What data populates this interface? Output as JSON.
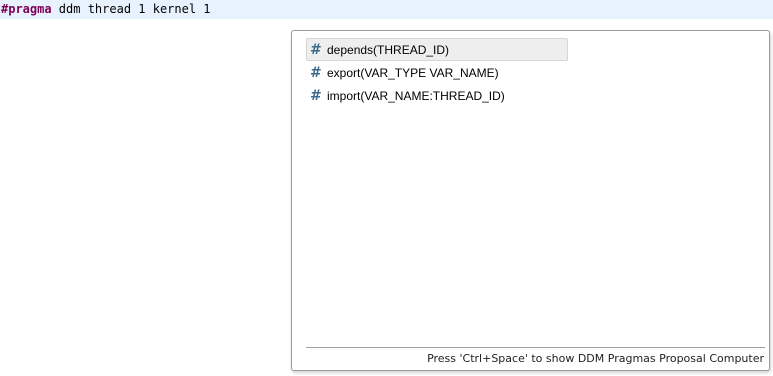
{
  "editor": {
    "keyword": "#pragma",
    "rest": " ddm thread 1 kernel 1",
    "keyword_color": "#7f0055",
    "line_highlight_color": "#e8f2fe"
  },
  "popup": {
    "items": [
      {
        "icon": "hash-icon",
        "label": "depends(THREAD_ID)",
        "selected": true
      },
      {
        "icon": "hash-icon",
        "label": "export(VAR_TYPE VAR_NAME)",
        "selected": false
      },
      {
        "icon": "hash-icon",
        "label": "import(VAR_NAME:THREAD_ID)",
        "selected": false
      }
    ],
    "status_text": "Press 'Ctrl+Space' to show DDM Pragmas Proposal Computer"
  }
}
